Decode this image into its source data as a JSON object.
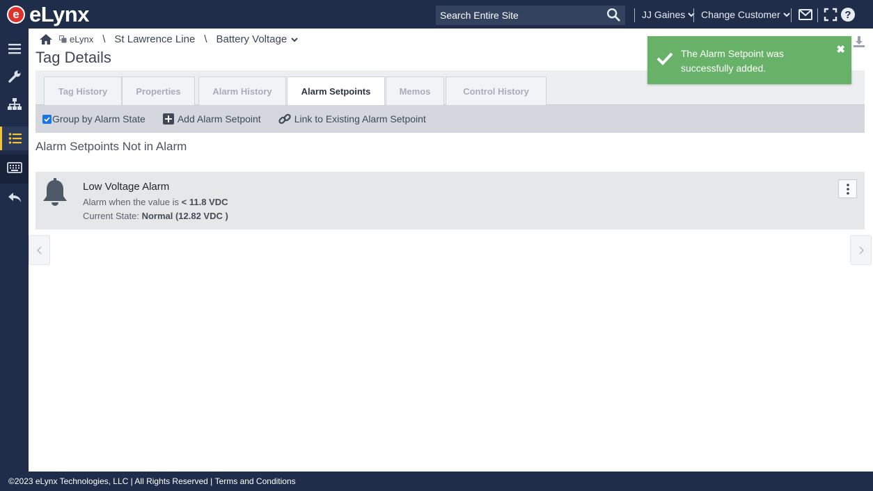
{
  "app": {
    "logo_text": "eLynx",
    "logo_mark": "e"
  },
  "header": {
    "search_placeholder": "Search Entire Site",
    "user_label": "JJ Gaines",
    "customer_label": "Change Customer",
    "icons": [
      "search-icon",
      "mail-icon",
      "fullscreen-icon",
      "help-icon"
    ]
  },
  "sidebar": {
    "items": [
      {
        "icon": "menu-icon"
      },
      {
        "icon": "wrench-icon"
      },
      {
        "icon": "hierarchy-icon"
      },
      {
        "icon": "list-icon",
        "active": true
      },
      {
        "icon": "keyboard-icon"
      },
      {
        "icon": "back-icon"
      }
    ],
    "active_color": "#f4c430"
  },
  "breadcrumb": {
    "root": "eLynx",
    "level1": "St Lawrence Line",
    "level2": "Battery Voltage"
  },
  "page": {
    "title": "Tag Details"
  },
  "tabs": [
    {
      "label": "Tag History"
    },
    {
      "label": "Properties"
    },
    {
      "label": "Alarm History"
    },
    {
      "label": "Alarm Setpoints",
      "active": true
    },
    {
      "label": "Memos"
    },
    {
      "label": "Control History"
    }
  ],
  "toolbar": {
    "group_by_label": "Group by Alarm State",
    "group_by_checked": true,
    "add_label": "Add Alarm Setpoint",
    "link_label": "Link to Existing Alarm Setpoint"
  },
  "section": {
    "title": "Alarm Setpoints Not in Alarm"
  },
  "alarm": {
    "name": "Low Voltage Alarm",
    "condition_prefix": "Alarm when the value is",
    "condition_value": "< 11.8 VDC",
    "state_prefix": "Current State:",
    "state_value": "Normal (12.82 VDC )"
  },
  "toast": {
    "message": "The Alarm Setpoint was successfully added.",
    "color": "#68b168"
  },
  "footer": {
    "copyright": "©2023 eLynx Technologies, LLC | All Rights Reserved | ",
    "terms_link": "Terms and Conditions"
  },
  "colors": {
    "nav": "#1f2d4a",
    "toolbar": "#d4d8de",
    "card": "#e6e7e9"
  }
}
